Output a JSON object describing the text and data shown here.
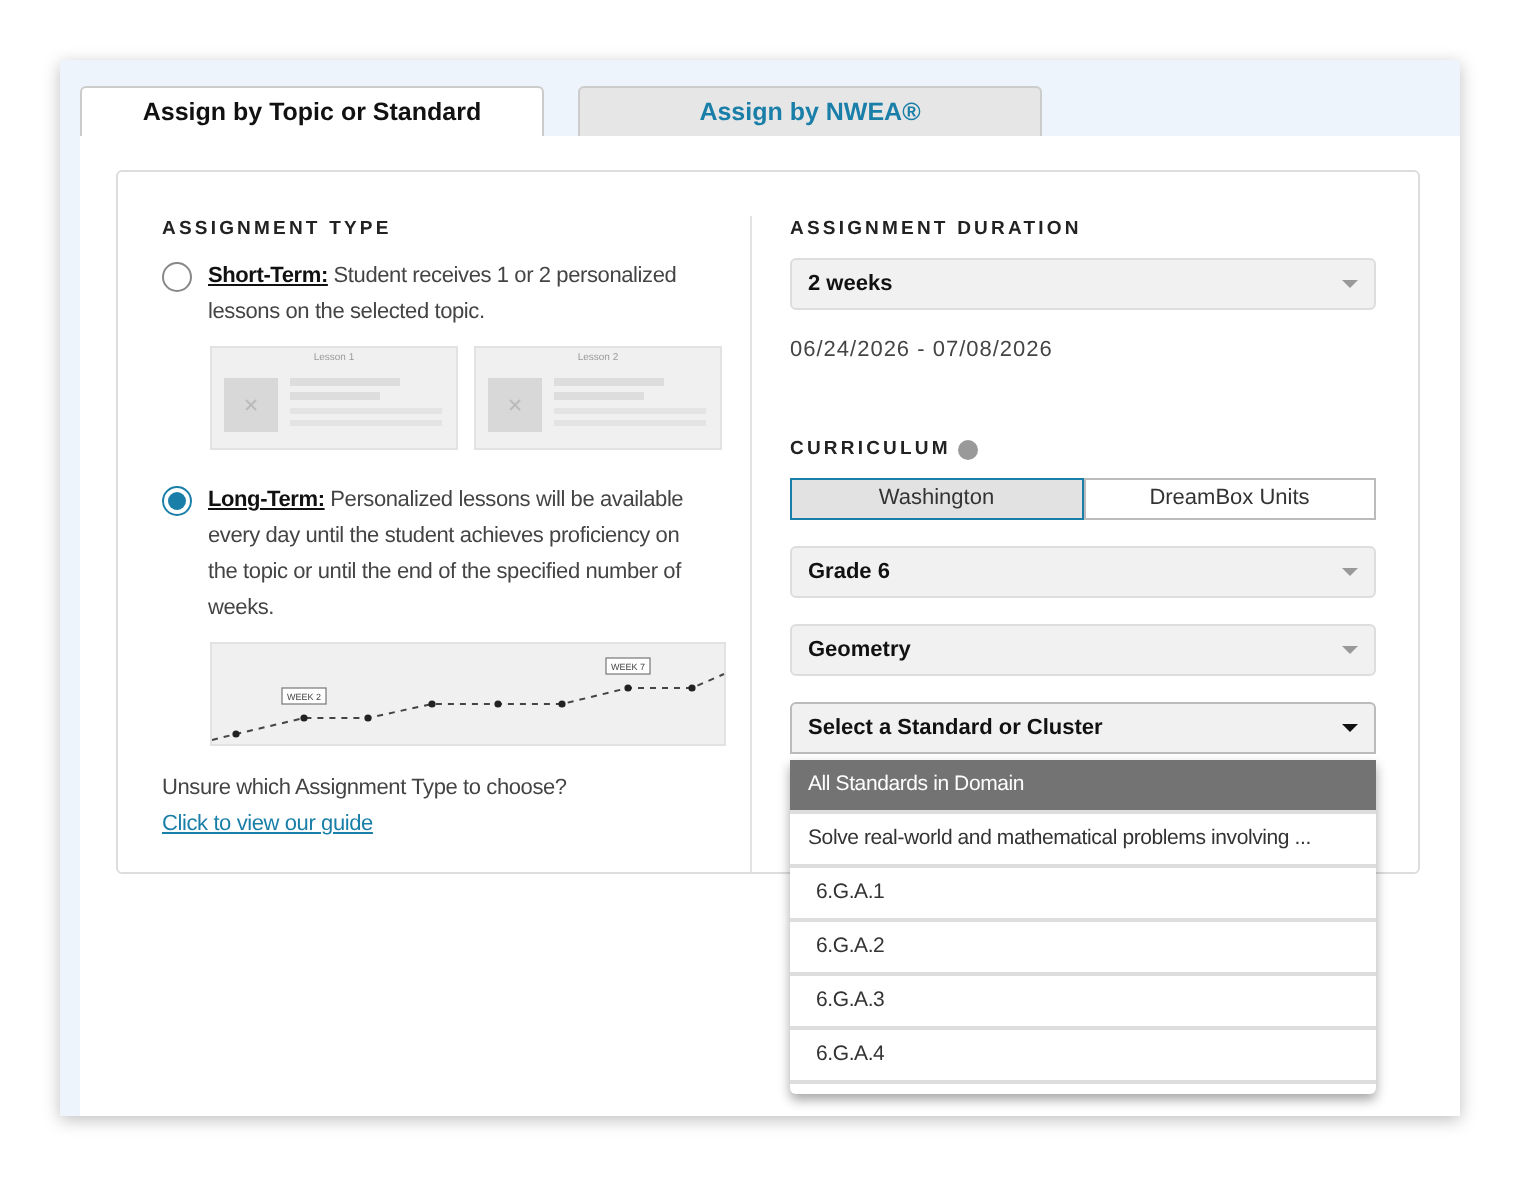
{
  "tabs": [
    {
      "label": "Assign by Topic or Standard",
      "selected": true
    },
    {
      "label": "Assign by NWEA®",
      "selected": false
    }
  ],
  "assignment_type": {
    "heading": "ASSIGNMENT TYPE",
    "options": [
      {
        "title": "Short-Term:",
        "description": "Student receives 1 or 2 personalized lessons on the selected topic.",
        "selected": false,
        "kind": "lessons",
        "thumbnails": [
          "Lesson 1",
          "Lesson 2"
        ]
      },
      {
        "title": "Long-Term:",
        "description": "Personalized lessons will be available every day until the student achieves proficiency on the topic or until the end of the specified number of weeks.",
        "selected": true,
        "kind": "timeline",
        "markers": [
          "WEEK 2",
          "WEEK 7"
        ]
      }
    ],
    "help_text": "Unsure which Assignment Type to choose?",
    "help_link": "Click to view our guide"
  },
  "duration": {
    "heading": "ASSIGNMENT DURATION",
    "value": "2 weeks",
    "dates": "06/24/2026 - 07/08/2026"
  },
  "curriculum": {
    "heading": "CURRICULUM",
    "options": [
      {
        "label": "Washington",
        "selected": true
      },
      {
        "label": "DreamBox Units",
        "selected": false
      }
    ],
    "selects": [
      {
        "value": "Grade 6",
        "open": false
      },
      {
        "value": "Geometry",
        "open": false
      },
      {
        "value": "Select a Standard or Cluster",
        "open": true
      }
    ],
    "dropdown": [
      {
        "label": "All Standards in Domain",
        "kind": "group",
        "selected": true
      },
      {
        "label": "Solve real-world and mathematical problems involving ...",
        "kind": "cluster",
        "selected": false
      },
      {
        "label": "6.G.A.1",
        "kind": "standard",
        "selected": false
      },
      {
        "label": "6.G.A.2",
        "kind": "standard",
        "selected": false
      },
      {
        "label": "6.G.A.3",
        "kind": "standard",
        "selected": false
      },
      {
        "label": "6.G.A.4",
        "kind": "standard",
        "selected": false
      }
    ]
  }
}
